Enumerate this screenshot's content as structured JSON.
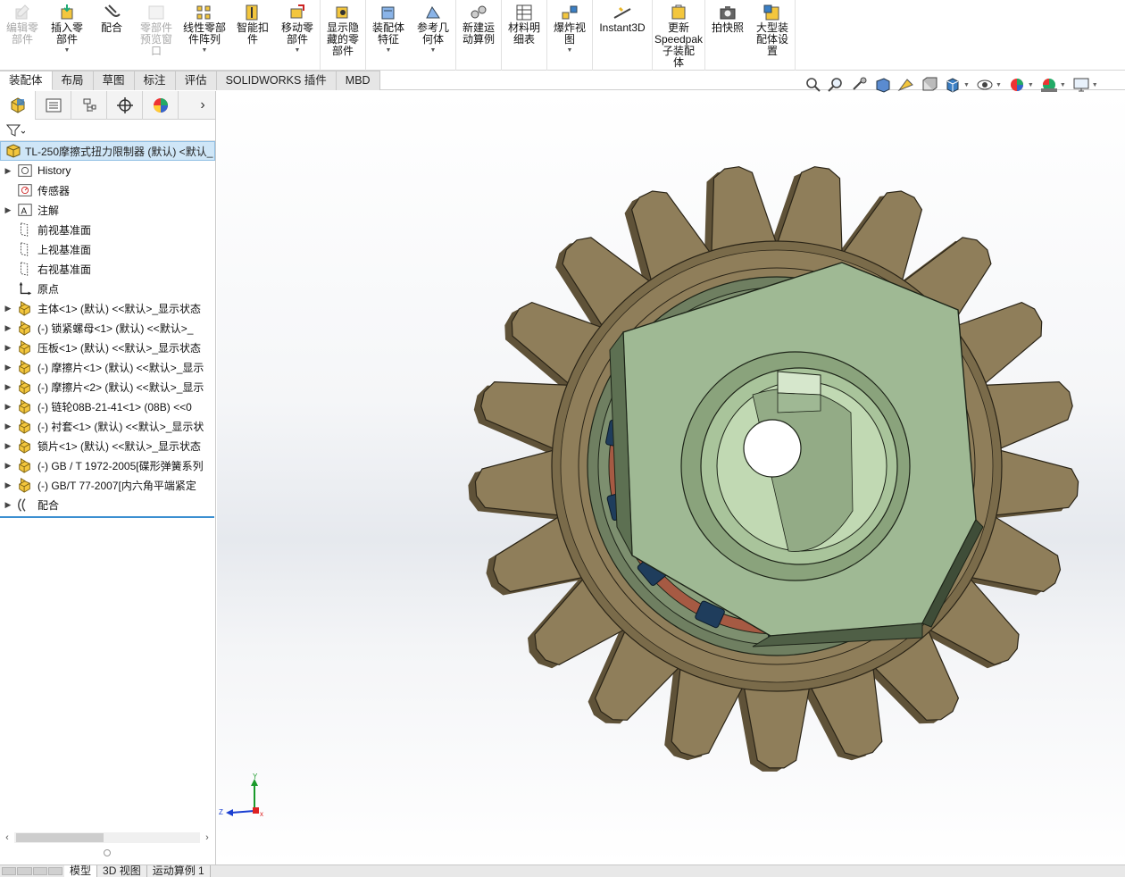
{
  "ribbon": {
    "groups": [
      [
        {
          "label": "编辑零\n部件",
          "icon": "edit-component-icon",
          "disabled": true
        },
        {
          "label": "插入零\n部件",
          "icon": "insert-component-icon",
          "caret": true
        },
        {
          "label": "配合",
          "icon": "mate-icon"
        },
        {
          "label": "零部件\n预览窗\n口",
          "icon": "component-preview-icon",
          "disabled": true
        },
        {
          "label": "线性零部\n件阵列",
          "icon": "linear-pattern-icon",
          "caret": true,
          "wide": true
        },
        {
          "label": "智能扣\n件",
          "icon": "smart-fastener-icon"
        },
        {
          "label": "移动零\n部件",
          "icon": "move-component-icon",
          "caret": true
        }
      ],
      [
        {
          "label": "显示隐\n藏的零\n部件",
          "icon": "show-hidden-icon"
        }
      ],
      [
        {
          "label": "装配体\n特征",
          "icon": "assembly-feature-icon",
          "caret": true
        },
        {
          "label": "参考几\n何体",
          "icon": "reference-geometry-icon",
          "caret": true
        }
      ],
      [
        {
          "label": "新建运\n动算例",
          "icon": "motion-study-icon"
        }
      ],
      [
        {
          "label": "材料明\n细表",
          "icon": "bom-icon"
        }
      ],
      [
        {
          "label": "爆炸视\n图",
          "icon": "exploded-view-icon",
          "caret": true
        }
      ],
      [
        {
          "label": "Instant3D",
          "icon": "instant3d-icon",
          "xwide": true
        }
      ],
      [
        {
          "label": "更新\nSpeedpak\n子装配\n体",
          "icon": "speedpak-icon",
          "wide": true
        }
      ],
      [
        {
          "label": "拍快照",
          "icon": "snapshot-icon"
        },
        {
          "label": "大型装\n配体设\n置",
          "icon": "large-assembly-icon"
        }
      ]
    ]
  },
  "command_tabs": [
    {
      "label": "装配体",
      "active": true
    },
    {
      "label": "布局"
    },
    {
      "label": "草图"
    },
    {
      "label": "标注"
    },
    {
      "label": "评估"
    },
    {
      "label": "SOLIDWORKS 插件"
    },
    {
      "label": "MBD"
    }
  ],
  "heads_up_toolbar": [
    "zoom-to-fit-icon",
    "zoom-to-area-icon",
    "previous-view-icon",
    "section-view-icon",
    "dynamic-annotation-icon",
    "view-orientation-icon",
    "display-style-icon",
    "hide-show-icon",
    "edit-appearance-icon",
    "apply-scene-icon",
    "view-settings-icon"
  ],
  "panel": {
    "root": "TL-250摩擦式扭力限制器 (默认) <默认_",
    "tree": [
      {
        "label": "History",
        "icon": "history-icon",
        "arrow": true
      },
      {
        "label": "传感器",
        "icon": "sensor-icon",
        "arrow": false
      },
      {
        "label": "注解",
        "icon": "annotation-icon",
        "arrow": true
      },
      {
        "label": "前视基准面",
        "icon": "plane-icon",
        "arrow": false
      },
      {
        "label": "上视基准面",
        "icon": "plane-icon",
        "arrow": false
      },
      {
        "label": "右视基准面",
        "icon": "plane-icon",
        "arrow": false
      },
      {
        "label": "原点",
        "icon": "origin-icon",
        "arrow": false
      },
      {
        "label": "主体<1> (默认) <<默认>_显示状态",
        "icon": "part-icon",
        "arrow": true
      },
      {
        "label": "(-) 锁紧螺母<1> (默认) <<默认>_",
        "icon": "part-icon",
        "arrow": true
      },
      {
        "label": "压板<1> (默认) <<默认>_显示状态",
        "icon": "part-icon",
        "arrow": true
      },
      {
        "label": "(-) 摩擦片<1> (默认) <<默认>_显示",
        "icon": "part-icon",
        "arrow": true
      },
      {
        "label": "(-) 摩擦片<2> (默认) <<默认>_显示",
        "icon": "part-icon",
        "arrow": true
      },
      {
        "label": "(-) 链轮08B-21-41<1> (08B) <<0",
        "icon": "part-icon",
        "arrow": true
      },
      {
        "label": "(-) 衬套<1> (默认) <<默认>_显示状",
        "icon": "part-icon",
        "arrow": true
      },
      {
        "label": "锁片<1> (默认) <<默认>_显示状态",
        "icon": "part-icon",
        "arrow": true
      },
      {
        "label": "(-) GB / T 1972-2005[碟形弹簧系列",
        "icon": "part-icon",
        "arrow": true
      },
      {
        "label": "(-) GB/T 77-2007[内六角平端紧定",
        "icon": "part-icon",
        "arrow": true
      },
      {
        "label": "配合",
        "icon": "mates-icon",
        "arrow": true
      }
    ]
  },
  "bottom_tabs": [
    {
      "label": "模型",
      "active": true
    },
    {
      "label": "3D 视图"
    },
    {
      "label": "运动算例 1"
    }
  ],
  "triad": {
    "x": "x",
    "y": "Y",
    "z": "Z"
  },
  "colors": {
    "sprocket": "#8f7e5a",
    "friction_disc": "#a65a43",
    "nut": "#9fb994",
    "pads": "#1f3d5c",
    "accent": "#3b8fd1"
  }
}
